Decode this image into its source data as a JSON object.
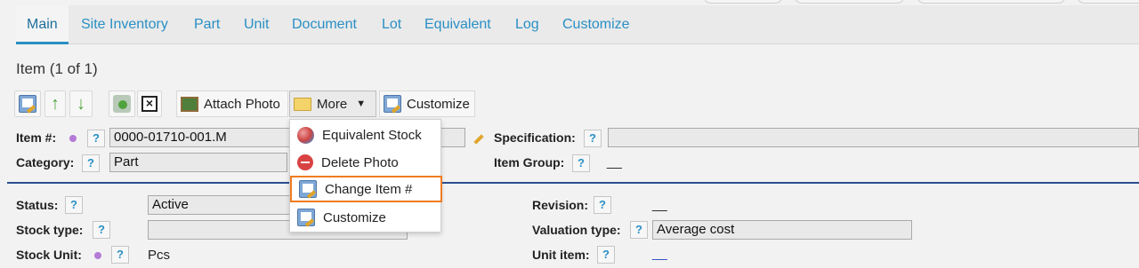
{
  "tabs": [
    {
      "label": "Main",
      "active": true
    },
    {
      "label": "Site Inventory"
    },
    {
      "label": "Part"
    },
    {
      "label": "Unit"
    },
    {
      "label": "Document"
    },
    {
      "label": "Lot"
    },
    {
      "label": "Equivalent"
    },
    {
      "label": "Log"
    },
    {
      "label": "Customize"
    }
  ],
  "title": "Item (1 of 1)",
  "toolbar": {
    "attach_photo": "Attach Photo",
    "more": "More",
    "customize": "Customize",
    "icons": [
      "notepad-edit-icon",
      "arrow-up-icon",
      "arrow-down-icon",
      "swap-icon",
      "close-x-icon",
      "photo-icon",
      "folder-icon",
      "notepad-edit-icon"
    ]
  },
  "help_glyph": "?",
  "fields": {
    "item_no": {
      "label": "Item #:",
      "value": "0000-01710-001.M"
    },
    "category": {
      "label": "Category:",
      "value": "Part"
    },
    "specification": {
      "label": "Specification:",
      "value": ""
    },
    "item_group": {
      "label": "Item Group:",
      "value": "__"
    },
    "status": {
      "label": "Status:",
      "value": "Active"
    },
    "stock_type": {
      "label": "Stock type:",
      "value": ""
    },
    "stock_unit": {
      "label": "Stock Unit:",
      "value": "Pcs"
    },
    "revision": {
      "label": "Revision:",
      "value": "__"
    },
    "valuation_type": {
      "label": "Valuation type:",
      "value": "Average cost"
    },
    "unit_item": {
      "label": "Unit item:",
      "value": "__"
    }
  },
  "more_menu": {
    "items": [
      {
        "label": "Equivalent Stock",
        "icon": "cubes-icon"
      },
      {
        "label": "Delete Photo",
        "icon": "delete-icon"
      },
      {
        "label": "Change Item #",
        "icon": "notepad-edit-icon",
        "focused": true
      },
      {
        "label": "Customize",
        "icon": "notepad-edit-icon"
      }
    ]
  },
  "colors": {
    "link": "#2a8fc4",
    "divider": "#2b4f8f",
    "focus_outline": "#f07c1f",
    "required_dot": "#b57ad6"
  }
}
